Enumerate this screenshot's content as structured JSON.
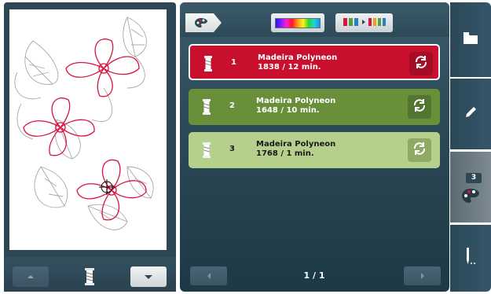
{
  "design": {
    "colors": [
      "#d9133f",
      "#7a7a7a"
    ]
  },
  "left_toolbar": {
    "up_icon": "triangle-up-icon",
    "spool_icon": "thread-spool-icon",
    "down_icon": "triangle-down-icon"
  },
  "top_toolbar": {
    "palette_icon": "palette-icon",
    "color_wheel_icon": "rainbow-bar-icon",
    "sort_icon": "spools-arrow-icon"
  },
  "threads": [
    {
      "number": "1",
      "brand": "Madeira Polyneon",
      "info": "1838 / 12 min.",
      "color": "#c8102e",
      "selected": true
    },
    {
      "number": "2",
      "brand": "Madeira Polyneon",
      "info": "1648 / 10 min.",
      "color": "#6a8f3a",
      "selected": false
    },
    {
      "number": "3",
      "brand": "Madeira Polyneon",
      "info": "1768 / 1 min.",
      "color": "#b5cf8c",
      "selected": false
    }
  ],
  "pagination": {
    "page": "1 / 1"
  },
  "side_tabs": {
    "color_count": "3"
  }
}
